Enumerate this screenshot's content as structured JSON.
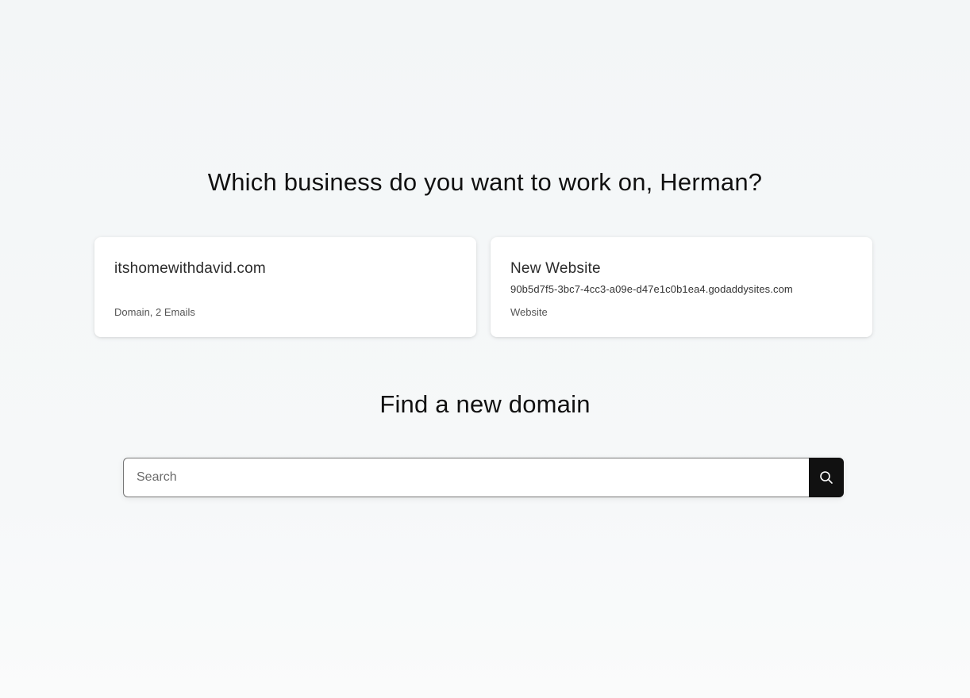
{
  "header": {
    "title": "Which business do you want to work on, Herman?"
  },
  "businesses": [
    {
      "name": "itshomewithdavid.com",
      "url": "",
      "products": "Domain, 2 Emails"
    },
    {
      "name": "New Website",
      "url": "90b5d7f5-3bc7-4cc3-a09e-d47e1c0b1ea4.godaddysites.com",
      "products": "Website"
    }
  ],
  "domain_search": {
    "title": "Find a new domain",
    "placeholder": "Search",
    "value": "",
    "button_icon": "search-icon"
  },
  "colors": {
    "background": "#f3f6f7",
    "card": "#ffffff",
    "search_button": "#111111",
    "text": "#111111"
  }
}
